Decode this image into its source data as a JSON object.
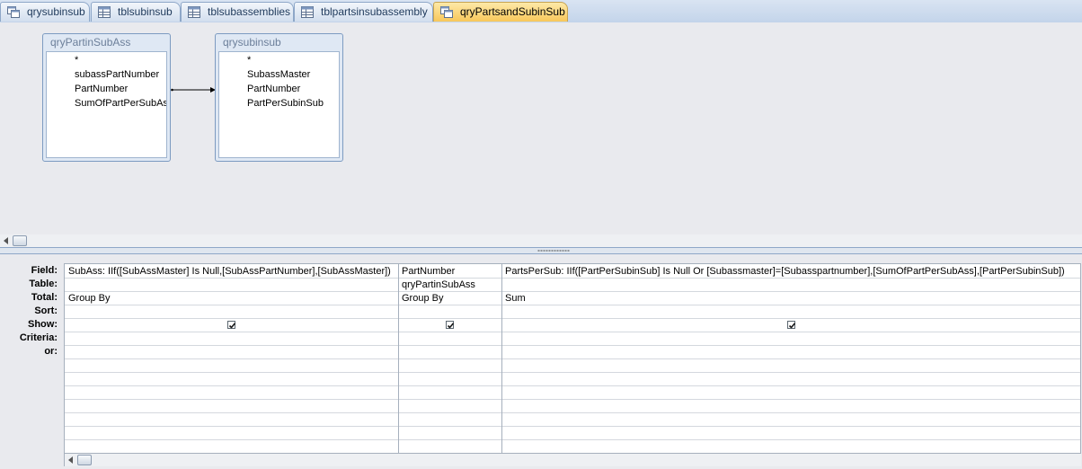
{
  "tabs": [
    {
      "label": "qrysubinsub",
      "icon": "query-icon",
      "active": false
    },
    {
      "label": "tblsubinsub",
      "icon": "table-icon",
      "active": false
    },
    {
      "label": "tblsubassemblies",
      "icon": "table-icon",
      "active": false
    },
    {
      "label": "tblpartsinsubassembly",
      "icon": "table-icon",
      "active": false
    },
    {
      "label": "qryPartsandSubinSub",
      "icon": "query-icon",
      "active": true
    }
  ],
  "field_lists": [
    {
      "title": "qryPartinSubAss",
      "fields": [
        "*",
        "subassPartNumber",
        "PartNumber",
        "SumOfPartPerSubAss"
      ]
    },
    {
      "title": "qrysubinsub",
      "fields": [
        "*",
        "SubassMaster",
        "PartNumber",
        "PartPerSubinSub"
      ]
    }
  ],
  "grid": {
    "row_labels": [
      "Field:",
      "Table:",
      "Total:",
      "Sort:",
      "Show:",
      "Criteria:",
      "or:"
    ],
    "columns": [
      {
        "field": "SubAss: IIf([SubAssMaster] Is Null,[SubAssPartNumber],[SubAssMaster])",
        "table": "",
        "total": "Group By",
        "sort": "",
        "show": true
      },
      {
        "field": "PartNumber",
        "table": "qryPartinSubAss",
        "total": "Group By",
        "sort": "",
        "show": true
      },
      {
        "field": "PartsPerSub: IIf([PartPerSubinSub] Is Null Or [Subassmaster]=[Subasspartnumber],[SumOfPartPerSubAss],[PartPerSubinSub])",
        "table": "",
        "total": "Sum",
        "sort": "",
        "show": true
      }
    ]
  },
  "colors": {
    "active_tab": "#f8c75a",
    "tab_border": "#8ea7c8",
    "background": "#e9eaee"
  }
}
